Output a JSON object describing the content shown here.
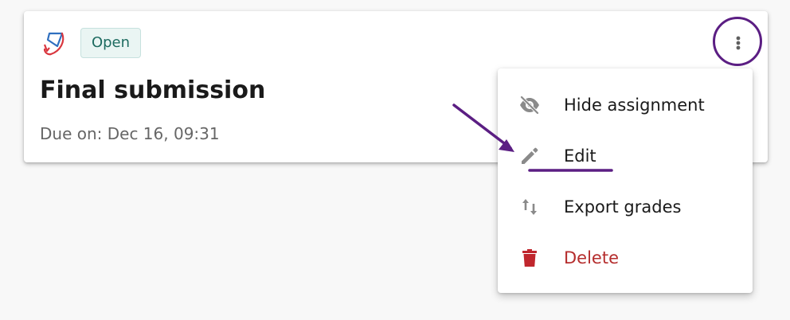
{
  "card": {
    "status_badge": "Open",
    "title": "Final submission",
    "due": "Due on: Dec 16, 09:31"
  },
  "menu": {
    "items": [
      {
        "label": "Hide assignment",
        "icon": "eye-off-icon"
      },
      {
        "label": "Edit",
        "icon": "pencil-icon"
      },
      {
        "label": "Export grades",
        "icon": "sort-arrows-icon"
      },
      {
        "label": "Delete",
        "icon": "trash-icon"
      }
    ]
  },
  "colors": {
    "annotation": "#5b1e83",
    "danger": "#b52d2d",
    "badge_text": "#1d6b60",
    "badge_bg": "#eaf5f3"
  }
}
